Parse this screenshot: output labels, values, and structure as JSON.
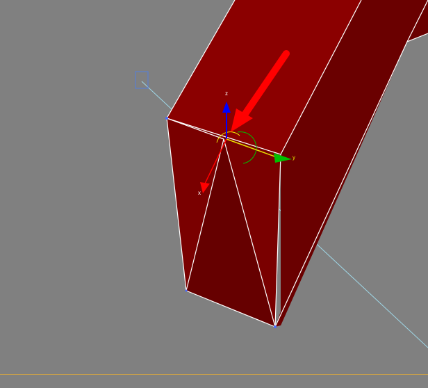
{
  "viewport": {
    "background_color": "#808080",
    "border_color": "#c8a04a"
  },
  "object": {
    "face_color_front": "#8b0000",
    "face_color_side": "#700000",
    "face_color_end": "#600000",
    "edge_color": "#ffffff"
  },
  "gizmo": {
    "x_axis_label": "x",
    "y_axis_label": "y",
    "z_axis_label": "z",
    "x_color": "#ff0000",
    "y_color": "#00c000",
    "z_color": "#0000ff",
    "ring_color": "#f0f000"
  },
  "annotation": {
    "arrow_color": "#ff0000",
    "arrow_icon": "red-arrow-icon"
  },
  "guide_line_color": "#9fd8e8",
  "light_icon": "light-target-icon"
}
